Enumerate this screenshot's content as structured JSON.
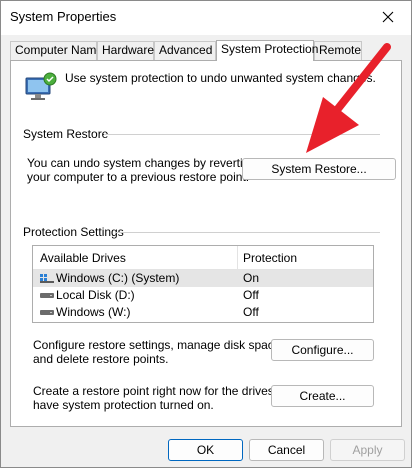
{
  "window": {
    "title": "System Properties"
  },
  "tabs": [
    {
      "label": "Computer Name"
    },
    {
      "label": "Hardware"
    },
    {
      "label": "Advanced"
    },
    {
      "label": "System Protection"
    },
    {
      "label": "Remote"
    }
  ],
  "intro": {
    "text": "Use system protection to undo unwanted system changes."
  },
  "system_restore": {
    "heading": "System Restore",
    "desc_line1": "You can undo system changes by reverting",
    "desc_line2": "your computer to a previous restore point.",
    "button_label": "System Restore..."
  },
  "protection_settings": {
    "heading": "Protection Settings",
    "columns": {
      "drives": "Available Drives",
      "protection": "Protection"
    },
    "drives": [
      {
        "name": "Windows (C:) (System)",
        "protection": "On",
        "icon": "windows-drive-icon"
      },
      {
        "name": "Local Disk (D:)",
        "protection": "Off",
        "icon": "disk-drive-icon"
      },
      {
        "name": "Windows (W:)",
        "protection": "Off",
        "icon": "disk-drive-icon"
      }
    ],
    "configure_line1": "Configure restore settings, manage disk space,",
    "configure_line2": "and delete restore points.",
    "configure_button": "Configure...",
    "create_line1": "Create a restore point right now for the drives that",
    "create_line2": "have system protection turned on.",
    "create_button": "Create..."
  },
  "footer": {
    "ok": "OK",
    "cancel": "Cancel",
    "apply": "Apply"
  },
  "colors": {
    "annotation_arrow": "#e8212b",
    "accent": "#0067c0"
  }
}
